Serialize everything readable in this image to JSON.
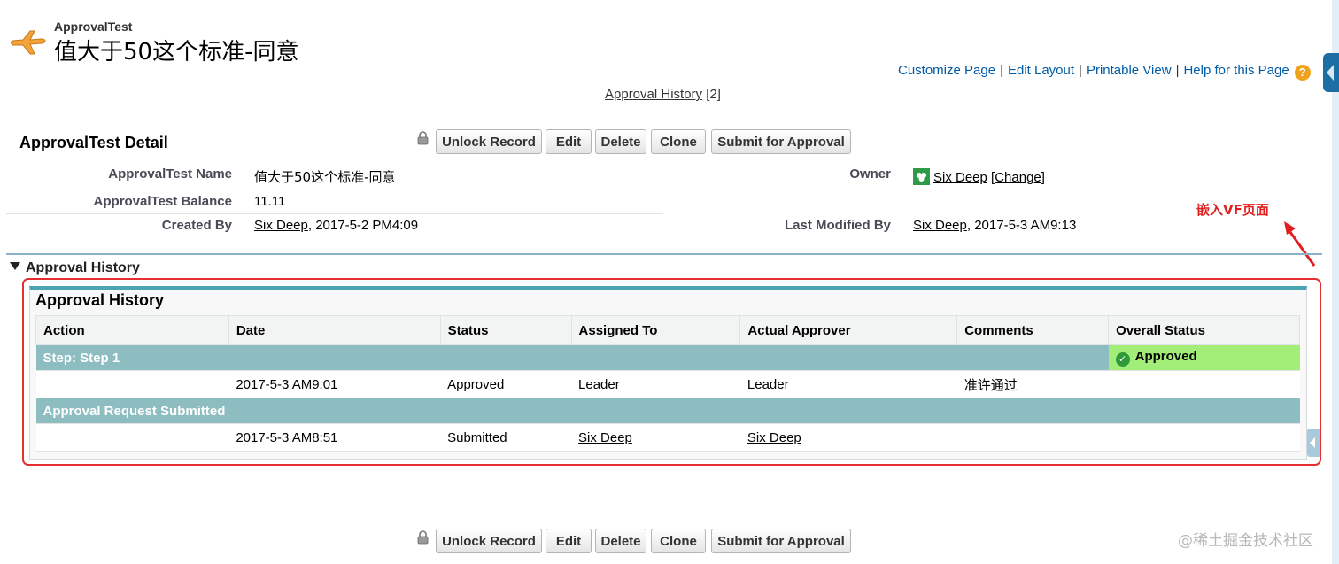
{
  "header": {
    "object_label": "ApprovalTest",
    "record_title": "值大于50这个标准-同意",
    "links": [
      "Customize Page",
      "Edit Layout",
      "Printable View",
      "Help for this Page"
    ],
    "help_icon_glyph": "?"
  },
  "related_list_link": {
    "label": "Approval History",
    "count": "[2]"
  },
  "detail": {
    "title": "ApprovalTest Detail",
    "buttons": [
      "Unlock Record",
      "Edit",
      "Delete",
      "Clone",
      "Submit for Approval"
    ],
    "fields": {
      "name_label": "ApprovalTest Name",
      "name_value": "值大于50这个标准-同意",
      "balance_label": "ApprovalTest Balance",
      "balance_value": "11.11",
      "created_by_label": "Created By",
      "created_by_user": "Six Deep",
      "created_by_date": ", 2017-5-2 PM4:09",
      "owner_label": "Owner",
      "owner_user": "Six Deep",
      "owner_change": "[Change]",
      "modified_label": "Last Modified By",
      "modified_user": "Six Deep",
      "modified_date": ", 2017-5-3 AM9:13"
    }
  },
  "annotation": {
    "text": "嵌入VF页面",
    "color": "#e02020"
  },
  "approval_section": {
    "heading": "Approval History"
  },
  "vf_panel": {
    "title": "Approval History",
    "columns": [
      "Action",
      "Date",
      "Status",
      "Assigned To",
      "Actual Approver",
      "Comments",
      "Overall Status"
    ],
    "groups": [
      {
        "step_label": "Step: Step 1",
        "overall_status": "Approved",
        "row": {
          "action": "",
          "date": "2017-5-3 AM9:01",
          "status": "Approved",
          "assigned_to": "Leader",
          "actual_approver": "Leader",
          "comments": "准许通过"
        }
      },
      {
        "step_label": "Approval Request Submitted",
        "overall_status": "",
        "row": {
          "action": "",
          "date": "2017-5-3 AM8:51",
          "status": "Submitted",
          "assigned_to": "Six Deep",
          "actual_approver": "Six Deep",
          "comments": ""
        }
      }
    ]
  },
  "bottom_buttons": [
    "Unlock Record",
    "Edit",
    "Delete",
    "Clone",
    "Submit for Approval"
  ],
  "watermark": "@稀土掘金技术社区",
  "colors": {
    "link_blue": "#015ba7",
    "step_row_teal": "#8dbdc0",
    "approved_green": "#a3ee79",
    "highlight_red": "#e2312f",
    "panel_accent": "#4aa5b3"
  }
}
